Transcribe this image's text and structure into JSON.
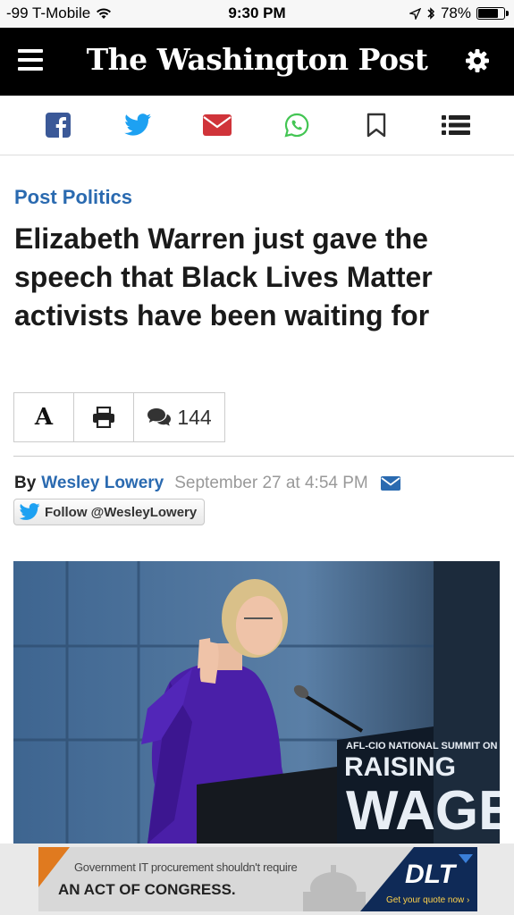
{
  "status_bar": {
    "carrier": "-99 T-Mobile",
    "time": "9:30 PM",
    "battery": "78%",
    "battery_level": 0.78
  },
  "header": {
    "masthead": "The Washington Post",
    "menu_icon": "hamburger-menu-icon",
    "settings_icon": "gear-icon"
  },
  "share_bar": {
    "icons": [
      "facebook-icon",
      "twitter-icon",
      "email-icon",
      "whatsapp-icon",
      "bookmark-icon",
      "list-icon"
    ],
    "colors": {
      "facebook": "#3b5998",
      "twitter": "#1da1f2",
      "email": "#d0343a",
      "whatsapp": "#43c553",
      "neutral": "#333333"
    }
  },
  "article": {
    "section": "Post Politics",
    "headline": "Elizabeth Warren just gave the speech that Black Lives Matter activists have been waiting for",
    "tools": {
      "font_label": "A",
      "comment_count": "144"
    },
    "byline": {
      "prefix": "By",
      "author": "Wesley Lowery",
      "timestamp": "September 27 at 4:54 PM"
    },
    "follow_button": "Follow @WesleyLowery",
    "photo": {
      "sign_line1": "AFL-CIO NATIONAL SUMMIT ON",
      "sign_line2": "RAISING",
      "sign_line3": "WAGES"
    }
  },
  "ad": {
    "line1": "Government IT procurement shouldn't require",
    "line2": "AN ACT OF CONGRESS.",
    "brand": "DLT",
    "cta": "Get your quote now ›"
  },
  "colors": {
    "accent_blue": "#2a6ab0",
    "header_bg": "#000000"
  }
}
